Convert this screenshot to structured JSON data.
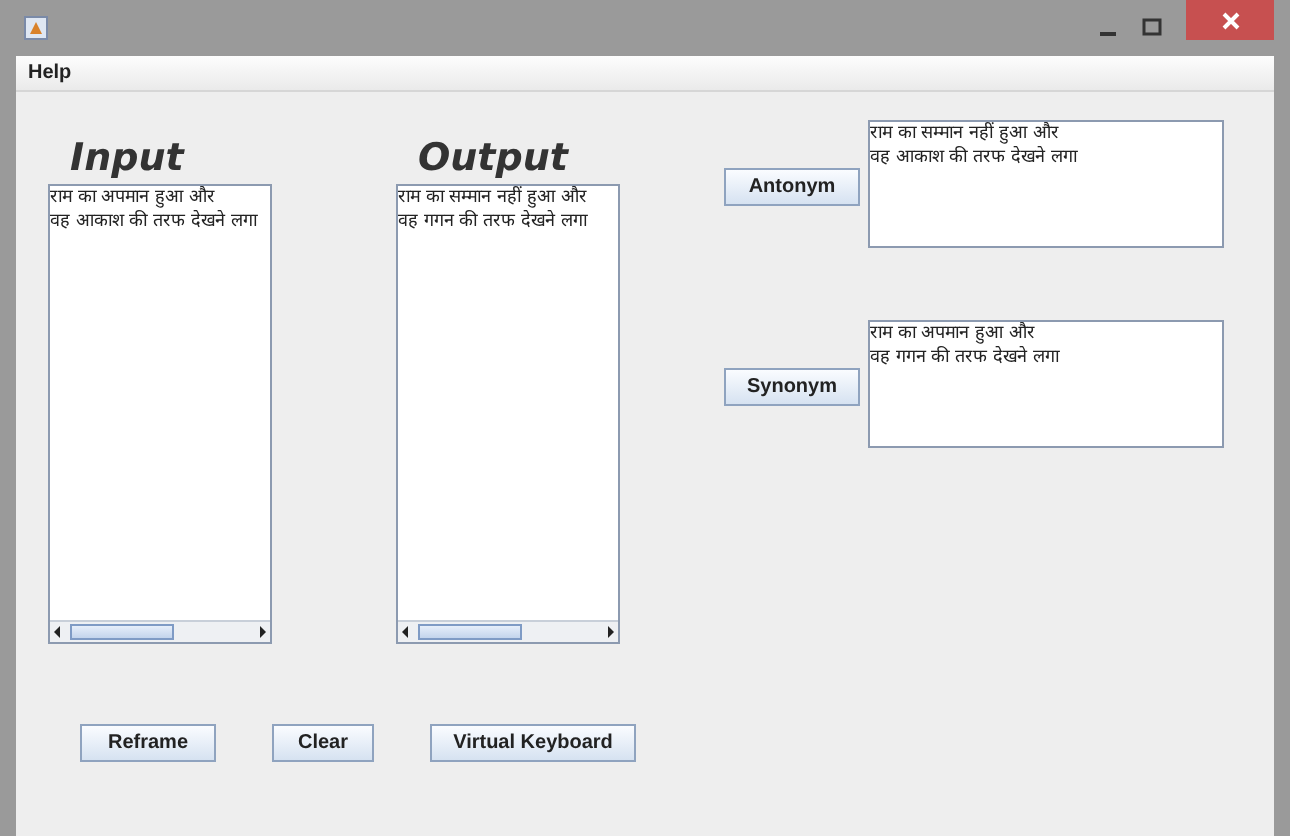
{
  "menu": [
    "Help"
  ],
  "input": {
    "title": "Input",
    "lines": [
      "राम का अपमान हुआ और",
      "वह आकाश की तरफ देखने लगा"
    ]
  },
  "output": {
    "title": "Output",
    "lines": [
      "राम का सम्मान नहीं हुआ और",
      "वह गगन की तरफ देखने लगा"
    ]
  },
  "transforms": [
    {
      "button": "Antonym",
      "lines": [
        "राम का सम्मान नहीं हुआ और",
        "वह आकाश की तरफ देखने लगा"
      ]
    },
    {
      "button": "Synonym",
      "lines": [
        "राम का अपमान हुआ और",
        "वह गगन की तरफ देखने लगा"
      ]
    }
  ],
  "buttons": [
    "Reframe",
    "Clear",
    "Virtual Keyboard"
  ]
}
